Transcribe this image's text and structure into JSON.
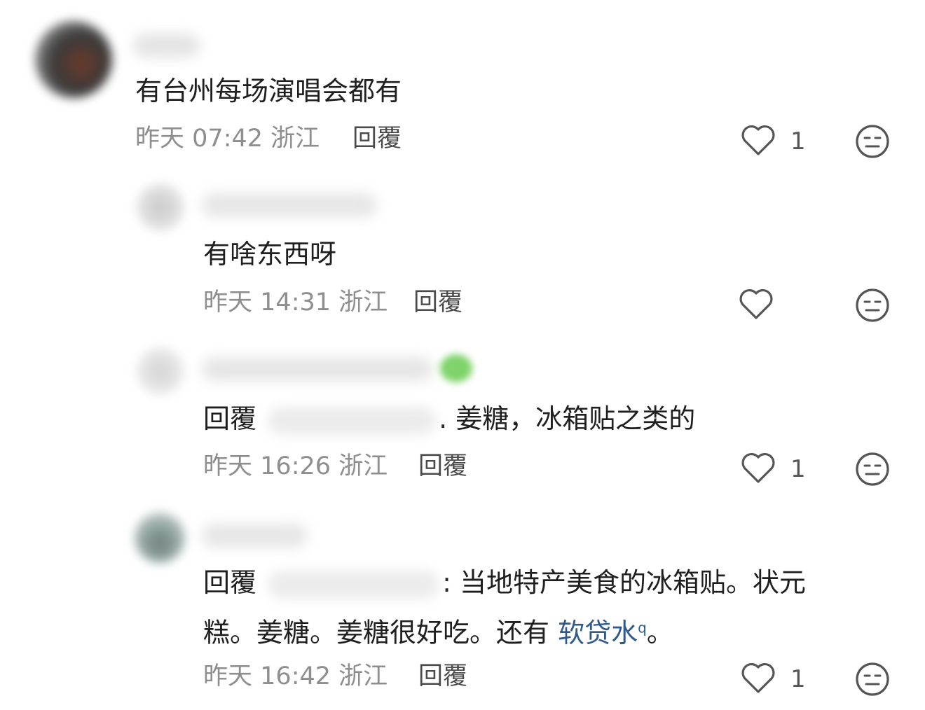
{
  "comments": [
    {
      "text": "有台州每场演唱会都有",
      "date": "昨天",
      "time": "07:42",
      "location": "浙江",
      "reply_label": "回覆",
      "likes": "1"
    },
    {
      "text": "有啥东西呀",
      "date": "昨天",
      "time": "14:31",
      "location": "浙江",
      "reply_label": "回覆",
      "likes": ""
    },
    {
      "reply_prefix": "回覆",
      "text": ". 姜糖，冰箱贴之类的",
      "date": "昨天",
      "time": "16:26",
      "location": "浙江",
      "reply_label": "回覆",
      "likes": "1"
    },
    {
      "reply_prefix": "回覆",
      "text_line1": ": 当地特产美食的冰箱贴。状元",
      "text_line2_a": "糕。姜糖。姜糖很好吃。还有",
      "link_text": "软贷水",
      "link_icon": "q",
      "text_line2_b": "。",
      "date": "昨天",
      "time": "16:42",
      "location": "浙江",
      "reply_label": "回覆",
      "likes": "1"
    }
  ],
  "icons": {
    "like": "heart-outline-icon",
    "dislike": "meh-face-icon",
    "link": "search-icon"
  },
  "colors": {
    "meta": "#8e8e8e",
    "link": "#2e5a8c",
    "icon": "#555555"
  }
}
